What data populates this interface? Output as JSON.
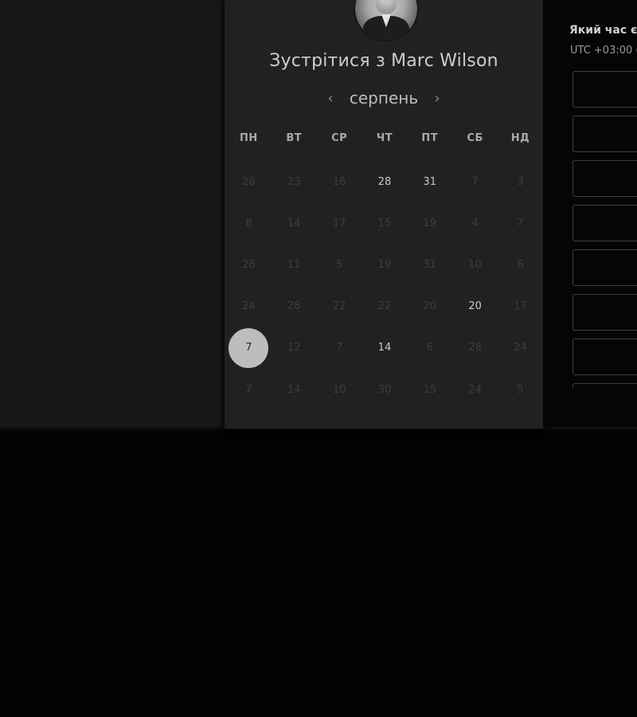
{
  "booking": {
    "title": "Зустрітися з Marc Wilson",
    "month": "серпень",
    "prev_icon": "chevron-left-icon",
    "next_icon": "chevron-right-icon"
  },
  "weekdays": [
    "ПН",
    "ВТ",
    "СР",
    "ЧТ",
    "ПТ",
    "СБ",
    "НД"
  ],
  "days": [
    {
      "label": "28",
      "available": false
    },
    {
      "label": "23",
      "available": false
    },
    {
      "label": "16",
      "available": false
    },
    {
      "label": "28",
      "available": true
    },
    {
      "label": "31",
      "available": true
    },
    {
      "label": "7",
      "available": false
    },
    {
      "label": "3",
      "available": false
    },
    {
      "label": "8",
      "available": false
    },
    {
      "label": "14",
      "available": false
    },
    {
      "label": "17",
      "available": false
    },
    {
      "label": "15",
      "available": false
    },
    {
      "label": "19",
      "available": false
    },
    {
      "label": "4",
      "available": false
    },
    {
      "label": "7",
      "available": false
    },
    {
      "label": "26",
      "available": false
    },
    {
      "label": "11",
      "available": false
    },
    {
      "label": "5",
      "available": false
    },
    {
      "label": "19",
      "available": false
    },
    {
      "label": "31",
      "available": false
    },
    {
      "label": "10",
      "available": false
    },
    {
      "label": "6",
      "available": false
    },
    {
      "label": "24",
      "available": false
    },
    {
      "label": "28",
      "available": false
    },
    {
      "label": "22",
      "available": false
    },
    {
      "label": "22",
      "available": false
    },
    {
      "label": "20",
      "available": false
    },
    {
      "label": "20",
      "available": true
    },
    {
      "label": "17",
      "available": false
    },
    {
      "label": "7",
      "available": true,
      "selected": true
    },
    {
      "label": "12",
      "available": false
    },
    {
      "label": "7",
      "available": false
    },
    {
      "label": "14",
      "available": true
    },
    {
      "label": "6",
      "available": false
    },
    {
      "label": "28",
      "available": false
    },
    {
      "label": "24",
      "available": false
    },
    {
      "label": "7",
      "available": false
    },
    {
      "label": "14",
      "available": false
    },
    {
      "label": "10",
      "available": false
    },
    {
      "label": "30",
      "available": false
    },
    {
      "label": "15",
      "available": false
    },
    {
      "label": "24",
      "available": false
    },
    {
      "label": "5",
      "available": false
    }
  ],
  "time_panel": {
    "question": "Який час є",
    "timezone": "UTC +03:00 (",
    "slot_count": 8
  }
}
